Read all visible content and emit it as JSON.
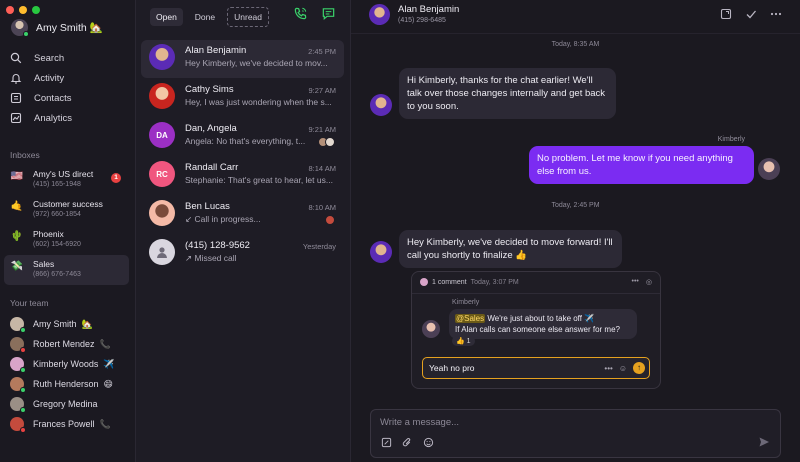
{
  "window": {
    "controls": [
      "close",
      "minimize",
      "zoom"
    ]
  },
  "user": {
    "name": "Amy Smith",
    "emoji": "🏡"
  },
  "nav": [
    {
      "label": "Search",
      "icon": "search-icon"
    },
    {
      "label": "Activity",
      "icon": "bell-icon"
    },
    {
      "label": "Contacts",
      "icon": "contacts-icon"
    },
    {
      "label": "Analytics",
      "icon": "analytics-icon"
    }
  ],
  "inboxes": {
    "title": "Inboxes",
    "items": [
      {
        "emoji": "🇺🇸",
        "name": "Amy's US direct",
        "number": "(415) 165-1948",
        "badge": "1"
      },
      {
        "emoji": "🤙",
        "name": "Customer success",
        "number": "(972) 660-1854",
        "badge": ""
      },
      {
        "emoji": "🌵",
        "name": "Phoenix",
        "number": "(602) 154-6920",
        "badge": ""
      },
      {
        "emoji": "💸",
        "name": "Sales",
        "number": "(866) 676-7463",
        "badge": ""
      }
    ]
  },
  "team": {
    "title": "Your team",
    "members": [
      {
        "name": "Amy Smith",
        "emoji": "🏡",
        "status_color": "#3ad16a",
        "avatar_color": "#c7b7a6"
      },
      {
        "name": "Robert Mendez",
        "emoji": "📞",
        "status_color": "#e94141",
        "avatar_color": "#8a6f5c"
      },
      {
        "name": "Kimberly Woods",
        "emoji": "✈️",
        "status_color": "#3ad16a",
        "avatar_color": "#d8a4c9"
      },
      {
        "name": "Ruth Henderson",
        "emoji": "😄",
        "status_color": "#3ad16a",
        "avatar_color": "#b47a5d"
      },
      {
        "name": "Gregory Medina",
        "emoji": "",
        "status_color": "#3ad16a",
        "avatar_color": "#9a8f86"
      },
      {
        "name": "Frances Powell",
        "emoji": "📞",
        "status_color": "#e94141",
        "avatar_color": "#c44b3d"
      }
    ]
  },
  "filters": {
    "open": "Open",
    "done": "Done",
    "unread": "Unread"
  },
  "conversations": [
    {
      "name": "Alan Benjamin",
      "time": "2:45 PM",
      "preview": "Hey Kimberly, we've decided to mov...",
      "avatar_color": "#6d3cc7",
      "initials": ""
    },
    {
      "name": "Cathy Sims",
      "time": "9:27 AM",
      "preview": "Hey, I was just wondering when the s...",
      "avatar_color": "#d3312c",
      "initials": ""
    },
    {
      "name": "Dan, Angela",
      "time": "9:21 AM",
      "preview": "Angela: No that's everything, t...",
      "avatar_color": "#9b2fc4",
      "initials": "DA"
    },
    {
      "name": "Randall Carr",
      "time": "8:14 AM",
      "preview": "Stephanie: That's great to hear, let us...",
      "avatar_color": "#f0567f",
      "initials": "RC"
    },
    {
      "name": "Ben Lucas",
      "time": "8:10 AM",
      "preview": "↙ Call in progress...",
      "avatar_color": "#f4b9a6",
      "initials": ""
    },
    {
      "name": "(415) 128-9562",
      "time": "Yesterday",
      "preview": "↗ Missed call",
      "avatar_color": "#d9d6df",
      "initials": ""
    }
  ],
  "chat": {
    "contact_name": "Alan Benjamin",
    "contact_number": "(415) 298-6485",
    "day_stamp_1": "Today, 8:35 AM",
    "day_stamp_2": "Today, 2:45 PM",
    "messages": [
      {
        "direction": "in",
        "text": "Hi Kimberly, thanks for the chat earlier! We'll talk over those changes internally and get back to you soon."
      },
      {
        "direction": "out",
        "sender": "Kimberly",
        "text": "No problem. Let me know if you need anything else from us."
      },
      {
        "direction": "in",
        "text": "Hey Kimberly, we've decided to move forward! I'll call you shortly to finalize 👍"
      }
    ],
    "thread": {
      "comment_count": "1 comment",
      "time": "Today, 3:07 PM",
      "sender": "Kimberly",
      "mention": "@Sales",
      "text_after_mention": " We're just about to take off ✈️",
      "text_line_2": "If Alan calls can someone else answer for me?",
      "reaction": "👍 1",
      "reply_value": "Yeah no pro"
    },
    "composer_placeholder": "Write a message..."
  }
}
